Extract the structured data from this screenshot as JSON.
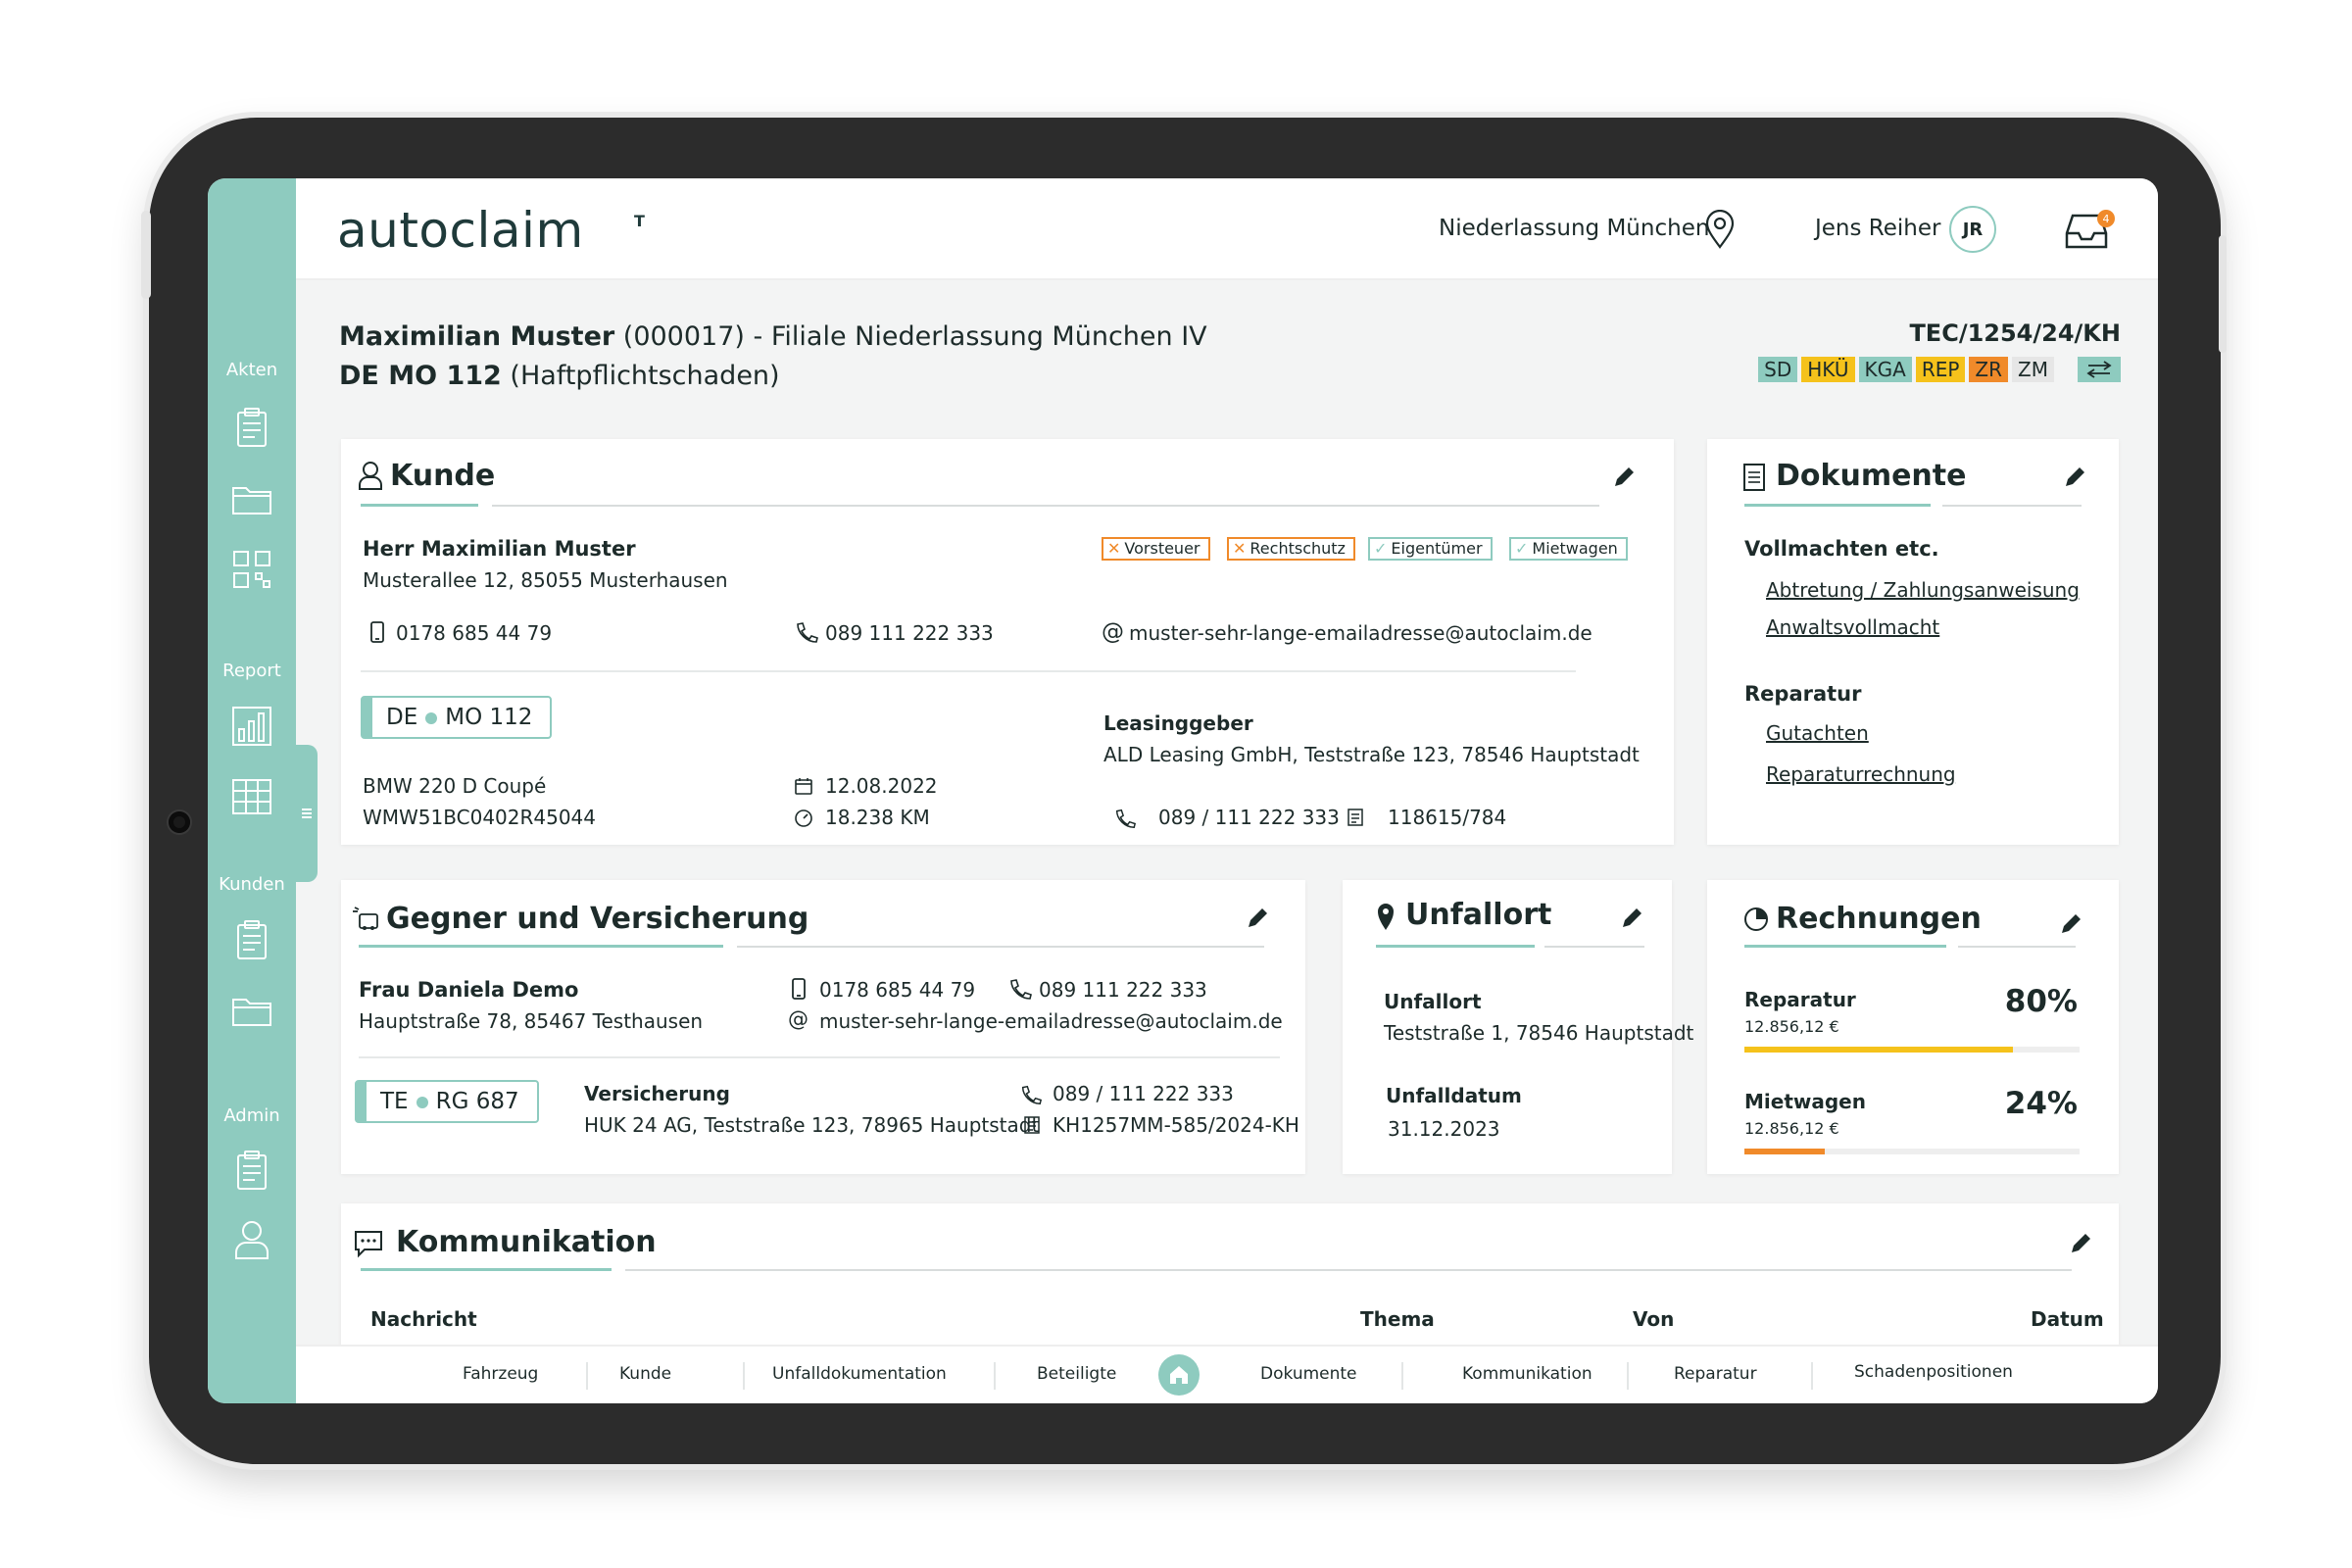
{
  "app": {
    "logo": "autoclaim",
    "logo_mark": "T"
  },
  "topbar": {
    "branch": "Niederlassung München",
    "user_name": "Jens Reiher",
    "user_initials": "JR",
    "inbox_count": "4"
  },
  "sidebar": {
    "sections": [
      "Akten",
      "Report",
      "Kunden",
      "Admin"
    ]
  },
  "case": {
    "customer": "Maximilian Muster",
    "customer_suffix": " (000017) - Filiale Niederlassung München IV",
    "plate": "DE MO 112",
    "type": " (Haftpflichtschaden)",
    "reference": "TEC/1254/24/KH",
    "tags": [
      {
        "label": "SD",
        "color": "#8ecbbf"
      },
      {
        "label": "HKÜ",
        "color": "#f5c21b"
      },
      {
        "label": "KGA",
        "color": "#8ecbbf"
      },
      {
        "label": "REP",
        "color": "#f5c21b"
      },
      {
        "label": "ZR",
        "color": "#f08a2a"
      },
      {
        "label": "ZM",
        "color": "#e6e6e6"
      }
    ]
  },
  "kunde": {
    "title": "Kunde",
    "name": "Herr Maximilian Muster",
    "address": "Musterallee 12, 85055 Musterhausen",
    "chips": [
      {
        "label": "Vorsteuer",
        "state": "x"
      },
      {
        "label": "Rechtschutz",
        "state": "x"
      },
      {
        "label": "Eigentümer",
        "state": "check"
      },
      {
        "label": "Mietwagen",
        "state": "check"
      }
    ],
    "mobile": "0178 685 44 79",
    "phone": "089 111 222 333",
    "email": "muster-sehr-lange-emailadresse@autoclaim.de",
    "plate_left": "DE",
    "plate_right": "MO 112",
    "vehicle": "BMW 220 D Coupé",
    "vin": "WMW51BC0402R45044",
    "date": "12.08.2022",
    "mileage": "18.238 KM",
    "leasing_label": "Leasinggeber",
    "leasing_address": "ALD Leasing GmbH, Teststraße 123, 78546 Hauptstadt",
    "leasing_phone": "089 / 111 222 333",
    "leasing_number": "118615/784"
  },
  "dokumente": {
    "title": "Dokumente",
    "group1": "Vollmachten etc.",
    "links1": [
      "Abtretung / Zahlungsanweisung",
      "Anwaltsvollmacht"
    ],
    "group2": "Reparatur",
    "links2": [
      "Gutachten",
      "Reparaturrechnung"
    ]
  },
  "gegner": {
    "title": "Gegner und Versicherung",
    "name": "Frau Daniela Demo",
    "address": "Hauptstraße 78, 85467 Testhausen",
    "mobile": "0178 685 44 79",
    "phone": "089 111 222 333",
    "email": "muster-sehr-lange-emailadresse@autoclaim.de",
    "plate_left": "TE",
    "plate_right": "RG 687",
    "insurance_label": "Versicherung",
    "insurance_address": "HUK 24 AG, Teststraße 123, 78965 Hauptstadt",
    "insurance_phone": "089 / 111 222 333",
    "insurance_number": "KH1257MM-585/2024-KH"
  },
  "unfallort": {
    "title": "Unfallort",
    "place_label": "Unfallort",
    "place": "Teststraße 1, 78546 Hauptstadt",
    "date_label": "Unfalldatum",
    "date": "31.12.2023"
  },
  "rechnungen": {
    "title": "Rechnungen",
    "items": [
      {
        "label": "Reparatur",
        "amount": "12.856,12 €",
        "percent": "80%",
        "fraction": 0.8,
        "color": "#f5c21b"
      },
      {
        "label": "Mietwagen",
        "amount": "12.856,12 €",
        "percent": "24%",
        "fraction": 0.24,
        "color": "#f08a2a"
      }
    ]
  },
  "kommunikation": {
    "title": "Kommunikation",
    "columns": [
      "Nachricht",
      "Thema",
      "Von",
      "Datum"
    ]
  },
  "bottomnav": {
    "items": [
      "Fahrzeug",
      "Kunde",
      "Unfalldokumentation",
      "Beteiligte",
      "Dokumente",
      "Kommunikation",
      "Reparatur",
      "Schadenpositionen"
    ]
  }
}
